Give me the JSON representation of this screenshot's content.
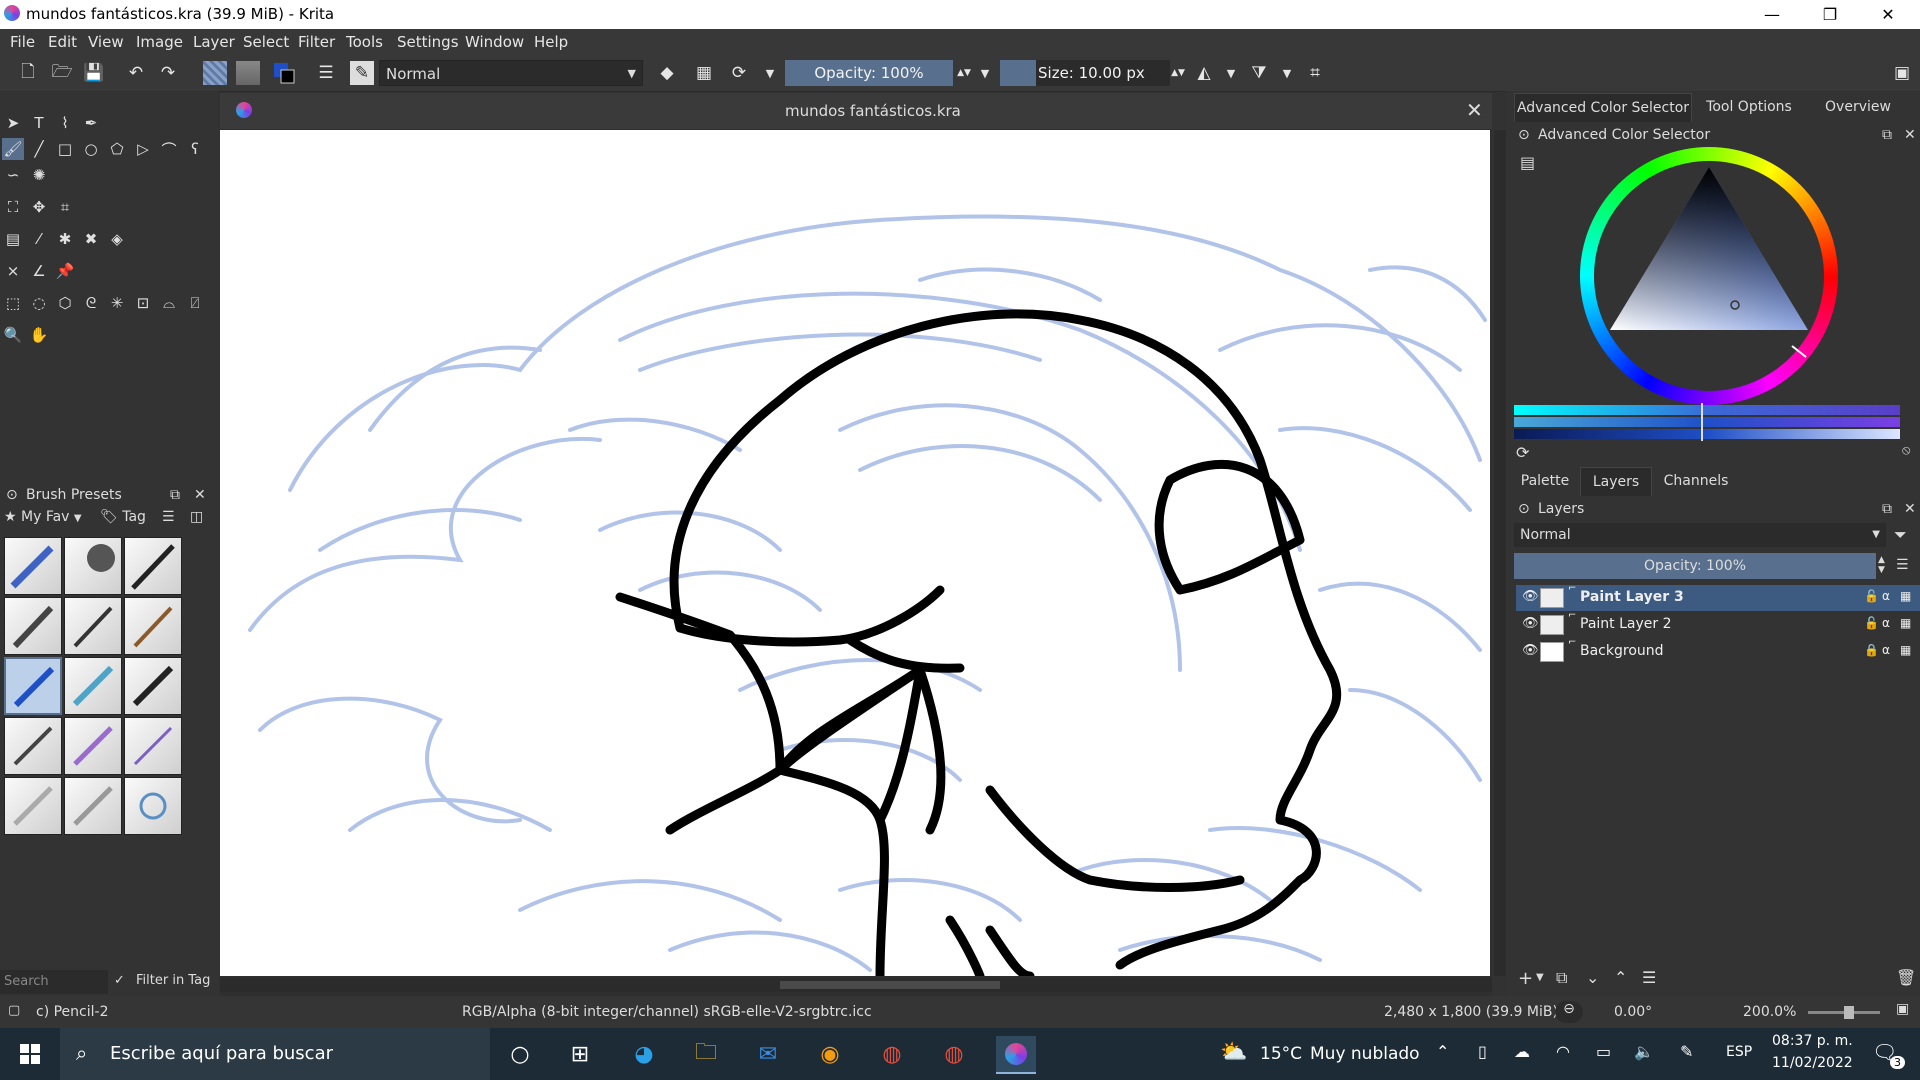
{
  "window": {
    "title": "mundos fantásticos.kra (39.9 MiB)  - Krita",
    "minimize": "—",
    "restore": "❐",
    "close": "✕"
  },
  "menu": [
    "File",
    "Edit",
    "View",
    "Image",
    "Layer",
    "Select",
    "Filter",
    "Tools",
    "Settings",
    "Window",
    "Help"
  ],
  "toolbar": {
    "blend_mode": "Normal",
    "opacity_label": "Opacity: 100%",
    "size_label": "Size: 10.00 px"
  },
  "brush_presets": {
    "title": "Brush Presets",
    "tag_filter": "My Fav",
    "tag_button": "Tag",
    "search_placeholder": "Search",
    "filter_in_tag": "Filter in Tag"
  },
  "document": {
    "tab_title": "mundos fantásticos.kra"
  },
  "right_tabs": [
    "Advanced Color Selector",
    "Tool Options",
    "Overview"
  ],
  "color_selector": {
    "title": "Advanced Color Selector"
  },
  "layer_tabs": [
    "Palette",
    "Layers",
    "Channels"
  ],
  "layers": {
    "title": "Layers",
    "blend_mode": "Normal",
    "opacity_label": "Opacity:  100%",
    "items": [
      {
        "name": "Paint Layer 3",
        "selected": true
      },
      {
        "name": "Paint Layer 2",
        "selected": false
      },
      {
        "name": "Background",
        "selected": false
      }
    ]
  },
  "status": {
    "brush": "c) Pencil-2",
    "color_space": "RGB/Alpha (8-bit integer/channel)  sRGB-elle-V2-srgbtrc.icc",
    "image_size": "2,480 x 1,800 (39.9 MiB)",
    "rotation": "0.00°",
    "zoom": "200.0%"
  },
  "taskbar": {
    "search_placeholder": "Escribe aquí para buscar",
    "weather_temp": "15°C",
    "weather_desc": "Muy nublado",
    "language": "ESP",
    "time": "08:37 p. m.",
    "date": "11/02/2022",
    "notifications": "3"
  },
  "colors": {
    "selection": "#3d5a80",
    "slider": "#58708e",
    "sketch": "#a9bde6"
  }
}
